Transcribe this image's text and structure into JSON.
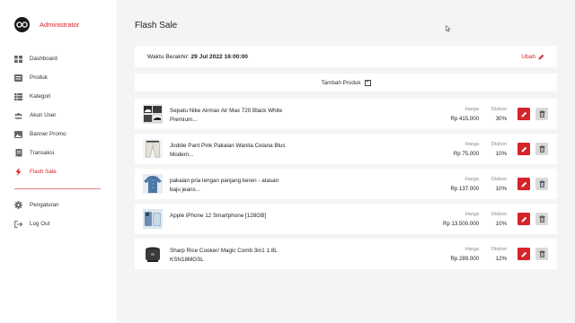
{
  "brand": {
    "name": "Administrator"
  },
  "nav": {
    "main": [
      {
        "label": "Dashboard",
        "icon": "grid-icon"
      },
      {
        "label": "Produk",
        "icon": "box-icon"
      },
      {
        "label": "Kategori",
        "icon": "table-icon"
      },
      {
        "label": "Akun User",
        "icon": "users-icon"
      },
      {
        "label": "Banner Promo",
        "icon": "image-icon"
      },
      {
        "label": "Transaksi",
        "icon": "receipt-icon"
      },
      {
        "label": "Flash Sale",
        "icon": "flash-icon",
        "active": true
      }
    ],
    "bottom": [
      {
        "label": "Pengaturan",
        "icon": "gear-icon"
      },
      {
        "label": "Log Out",
        "icon": "logout-icon"
      }
    ]
  },
  "page": {
    "title": "Flash Sale"
  },
  "deadline": {
    "label": "Waktu Berakhir:",
    "value": "29 Jul 2022 16:00:00",
    "edit_label": "Ubah"
  },
  "add_product": {
    "label": "Tambah Produk"
  },
  "columns": {
    "price": "Harga",
    "discount": "Diskon"
  },
  "products": [
    {
      "name": "Sepatu Nike Airmax Air Max 720 Black White Premium...",
      "price": "Rp 415.000",
      "discount": "30%",
      "thumb": "shoe"
    },
    {
      "name": "Joddie Pant Pink Pakaian Wanita Celana Blus Modern...",
      "price": "Rp 75.000",
      "discount": "10%",
      "thumb": "pants"
    },
    {
      "name": "pakaian pria lengan panjang keren - atasan baju jeans...",
      "price": "Rp 137.000",
      "discount": "10%",
      "thumb": "shirt"
    },
    {
      "name": "Apple iPhone 12 Smartphone [128GB]",
      "price": "Rp 13.500.000",
      "discount": "10%",
      "thumb": "phone"
    },
    {
      "name": "Sharp Rice Cooker/ Magic Comb 3in1 1.8L KSN18MGSL",
      "price": "Rp 289.000",
      "discount": "12%",
      "thumb": "cooker"
    }
  ],
  "colors": {
    "accent": "#d8232a",
    "background": "#f4f4f4",
    "delete_button": "#d9d9d9"
  }
}
